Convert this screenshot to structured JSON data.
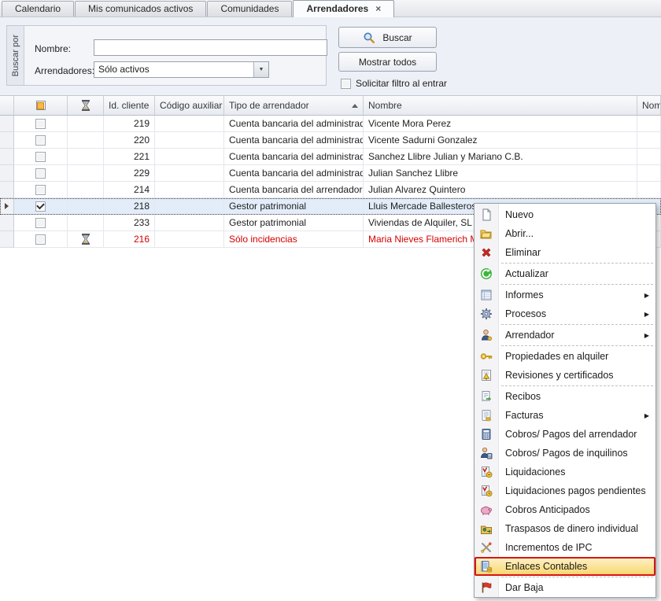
{
  "tabs": [
    {
      "label": "Calendario",
      "active": false
    },
    {
      "label": "Mis comunicados activos",
      "active": false
    },
    {
      "label": "Comunidades",
      "active": false
    },
    {
      "label": "Arrendadores",
      "active": true
    }
  ],
  "tab_close_glyph": "×",
  "search_panel": {
    "group_label": "Buscar por",
    "nombre_label": "Nombre:",
    "nombre_value": "",
    "arrendadores_label": "Arrendadores:",
    "arrendadores_value": "Sólo activos",
    "dropdown_glyph": "▼",
    "buscar_button": "Buscar",
    "mostrar_todos_button": "Mostrar todos",
    "solicitar_filtro_label": "Solicitar filtro al entrar",
    "solicitar_filtro_checked": false
  },
  "icons": {
    "buscar_button": "search-icon",
    "status_column": "hourglass-icon"
  },
  "grid": {
    "columns": [
      {
        "label": "Id. cliente"
      },
      {
        "label": "Código auxiliar"
      },
      {
        "label": "Tipo de arrendador",
        "sorted": "asc"
      },
      {
        "label": "Nombre"
      },
      {
        "label": "Nombre"
      }
    ],
    "rows": [
      {
        "checked": false,
        "status_icon": "",
        "id": "219",
        "codigo_auxiliar": "",
        "tipo": "Cuenta bancaria del administrador",
        "nombre": "Vicente Mora Perez",
        "red": false,
        "selected": false
      },
      {
        "checked": false,
        "status_icon": "",
        "id": "220",
        "codigo_auxiliar": "",
        "tipo": "Cuenta bancaria del administrador",
        "nombre": "Vicente Sadurni Gonzalez",
        "red": false,
        "selected": false
      },
      {
        "checked": false,
        "status_icon": "",
        "id": "221",
        "codigo_auxiliar": "",
        "tipo": "Cuenta bancaria del administrador",
        "nombre": "Sanchez Llibre Julian y Mariano C.B.",
        "red": false,
        "selected": false
      },
      {
        "checked": false,
        "status_icon": "",
        "id": "229",
        "codigo_auxiliar": "",
        "tipo": "Cuenta bancaria del administrador",
        "nombre": "Julian Sanchez Llibre",
        "red": false,
        "selected": false
      },
      {
        "checked": false,
        "status_icon": "",
        "id": "214",
        "codigo_auxiliar": "",
        "tipo": "Cuenta bancaria del arrendador",
        "nombre": "Julian Alvarez Quintero",
        "red": false,
        "selected": false
      },
      {
        "checked": true,
        "status_icon": "",
        "id": "218",
        "codigo_auxiliar": "",
        "tipo": "Gestor patrimonial",
        "nombre": "Lluis Mercade Ballesteros",
        "red": false,
        "selected": true
      },
      {
        "checked": false,
        "status_icon": "",
        "id": "233",
        "codigo_auxiliar": "",
        "tipo": "Gestor patrimonial",
        "nombre": "Viviendas de Alquiler, SL",
        "red": false,
        "selected": false
      },
      {
        "checked": false,
        "status_icon": "hourglass-icon",
        "id": "216",
        "codigo_auxiliar": "",
        "tipo": "Sólo incidencias",
        "nombre": "Maria Nieves Flamerich Mira",
        "red": true,
        "selected": false
      }
    ]
  },
  "context_menu": {
    "submenu_glyph": "▶",
    "items": [
      {
        "icon": "new-page-icon",
        "label": "Nuevo",
        "submenu": false,
        "highlighted": false,
        "separator_after": false
      },
      {
        "icon": "open-folder-icon",
        "label": "Abrir...",
        "submenu": false,
        "highlighted": false,
        "separator_after": false
      },
      {
        "icon": "delete-icon",
        "label": "Eliminar",
        "submenu": false,
        "highlighted": false,
        "separator_after": true
      },
      {
        "icon": "refresh-icon",
        "label": "Actualizar",
        "submenu": false,
        "highlighted": false,
        "separator_after": true
      },
      {
        "icon": "report-icon",
        "label": "Informes",
        "submenu": true,
        "highlighted": false,
        "separator_after": false
      },
      {
        "icon": "gear-icon",
        "label": "Procesos",
        "submenu": true,
        "highlighted": false,
        "separator_after": true
      },
      {
        "icon": "landlord-icon",
        "label": "Arrendador",
        "submenu": true,
        "highlighted": false,
        "separator_after": true
      },
      {
        "icon": "key-icon",
        "label": "Propiedades en alquiler",
        "submenu": false,
        "highlighted": false,
        "separator_after": false
      },
      {
        "icon": "certificate-icon",
        "label": "Revisiones y certificados",
        "submenu": false,
        "highlighted": false,
        "separator_after": true
      },
      {
        "icon": "receipt-icon",
        "label": "Recibos",
        "submenu": false,
        "highlighted": false,
        "separator_after": false
      },
      {
        "icon": "invoice-icon",
        "label": "Facturas",
        "submenu": true,
        "highlighted": false,
        "separator_after": false
      },
      {
        "icon": "calculator-icon",
        "label": "Cobros/ Pagos del arrendador",
        "submenu": false,
        "highlighted": false,
        "separator_after": false
      },
      {
        "icon": "tenant-payments-icon",
        "label": "Cobros/ Pagos de inquilinos",
        "submenu": false,
        "highlighted": false,
        "separator_after": false
      },
      {
        "icon": "liquidation-icon",
        "label": "Liquidaciones",
        "submenu": false,
        "highlighted": false,
        "separator_after": false
      },
      {
        "icon": "liquidation-pending-icon",
        "label": "Liquidaciones pagos pendientes",
        "submenu": false,
        "highlighted": false,
        "separator_after": false
      },
      {
        "icon": "piggy-bank-icon",
        "label": "Cobros Anticipados",
        "submenu": false,
        "highlighted": false,
        "separator_after": false
      },
      {
        "icon": "money-transfer-icon",
        "label": "Traspasos de dinero individual",
        "submenu": false,
        "highlighted": false,
        "separator_after": false
      },
      {
        "icon": "ipc-tools-icon",
        "label": "Incrementos de IPC",
        "submenu": false,
        "highlighted": false,
        "separator_after": false
      },
      {
        "icon": "ledger-icon",
        "label": "Enlaces Contables",
        "submenu": false,
        "highlighted": true,
        "separator_after": true
      },
      {
        "icon": "red-flag-icon",
        "label": "Dar Baja",
        "submenu": false,
        "highlighted": false,
        "separator_after": false
      }
    ]
  },
  "colors": {
    "selection-bg": "#e3edf9",
    "alert-text": "#d40000",
    "highlight-top": "#fdf3cd",
    "highlight-bottom": "#f9d468",
    "annotation-red": "#d81414",
    "highlight-inner": "#e6a33c"
  }
}
